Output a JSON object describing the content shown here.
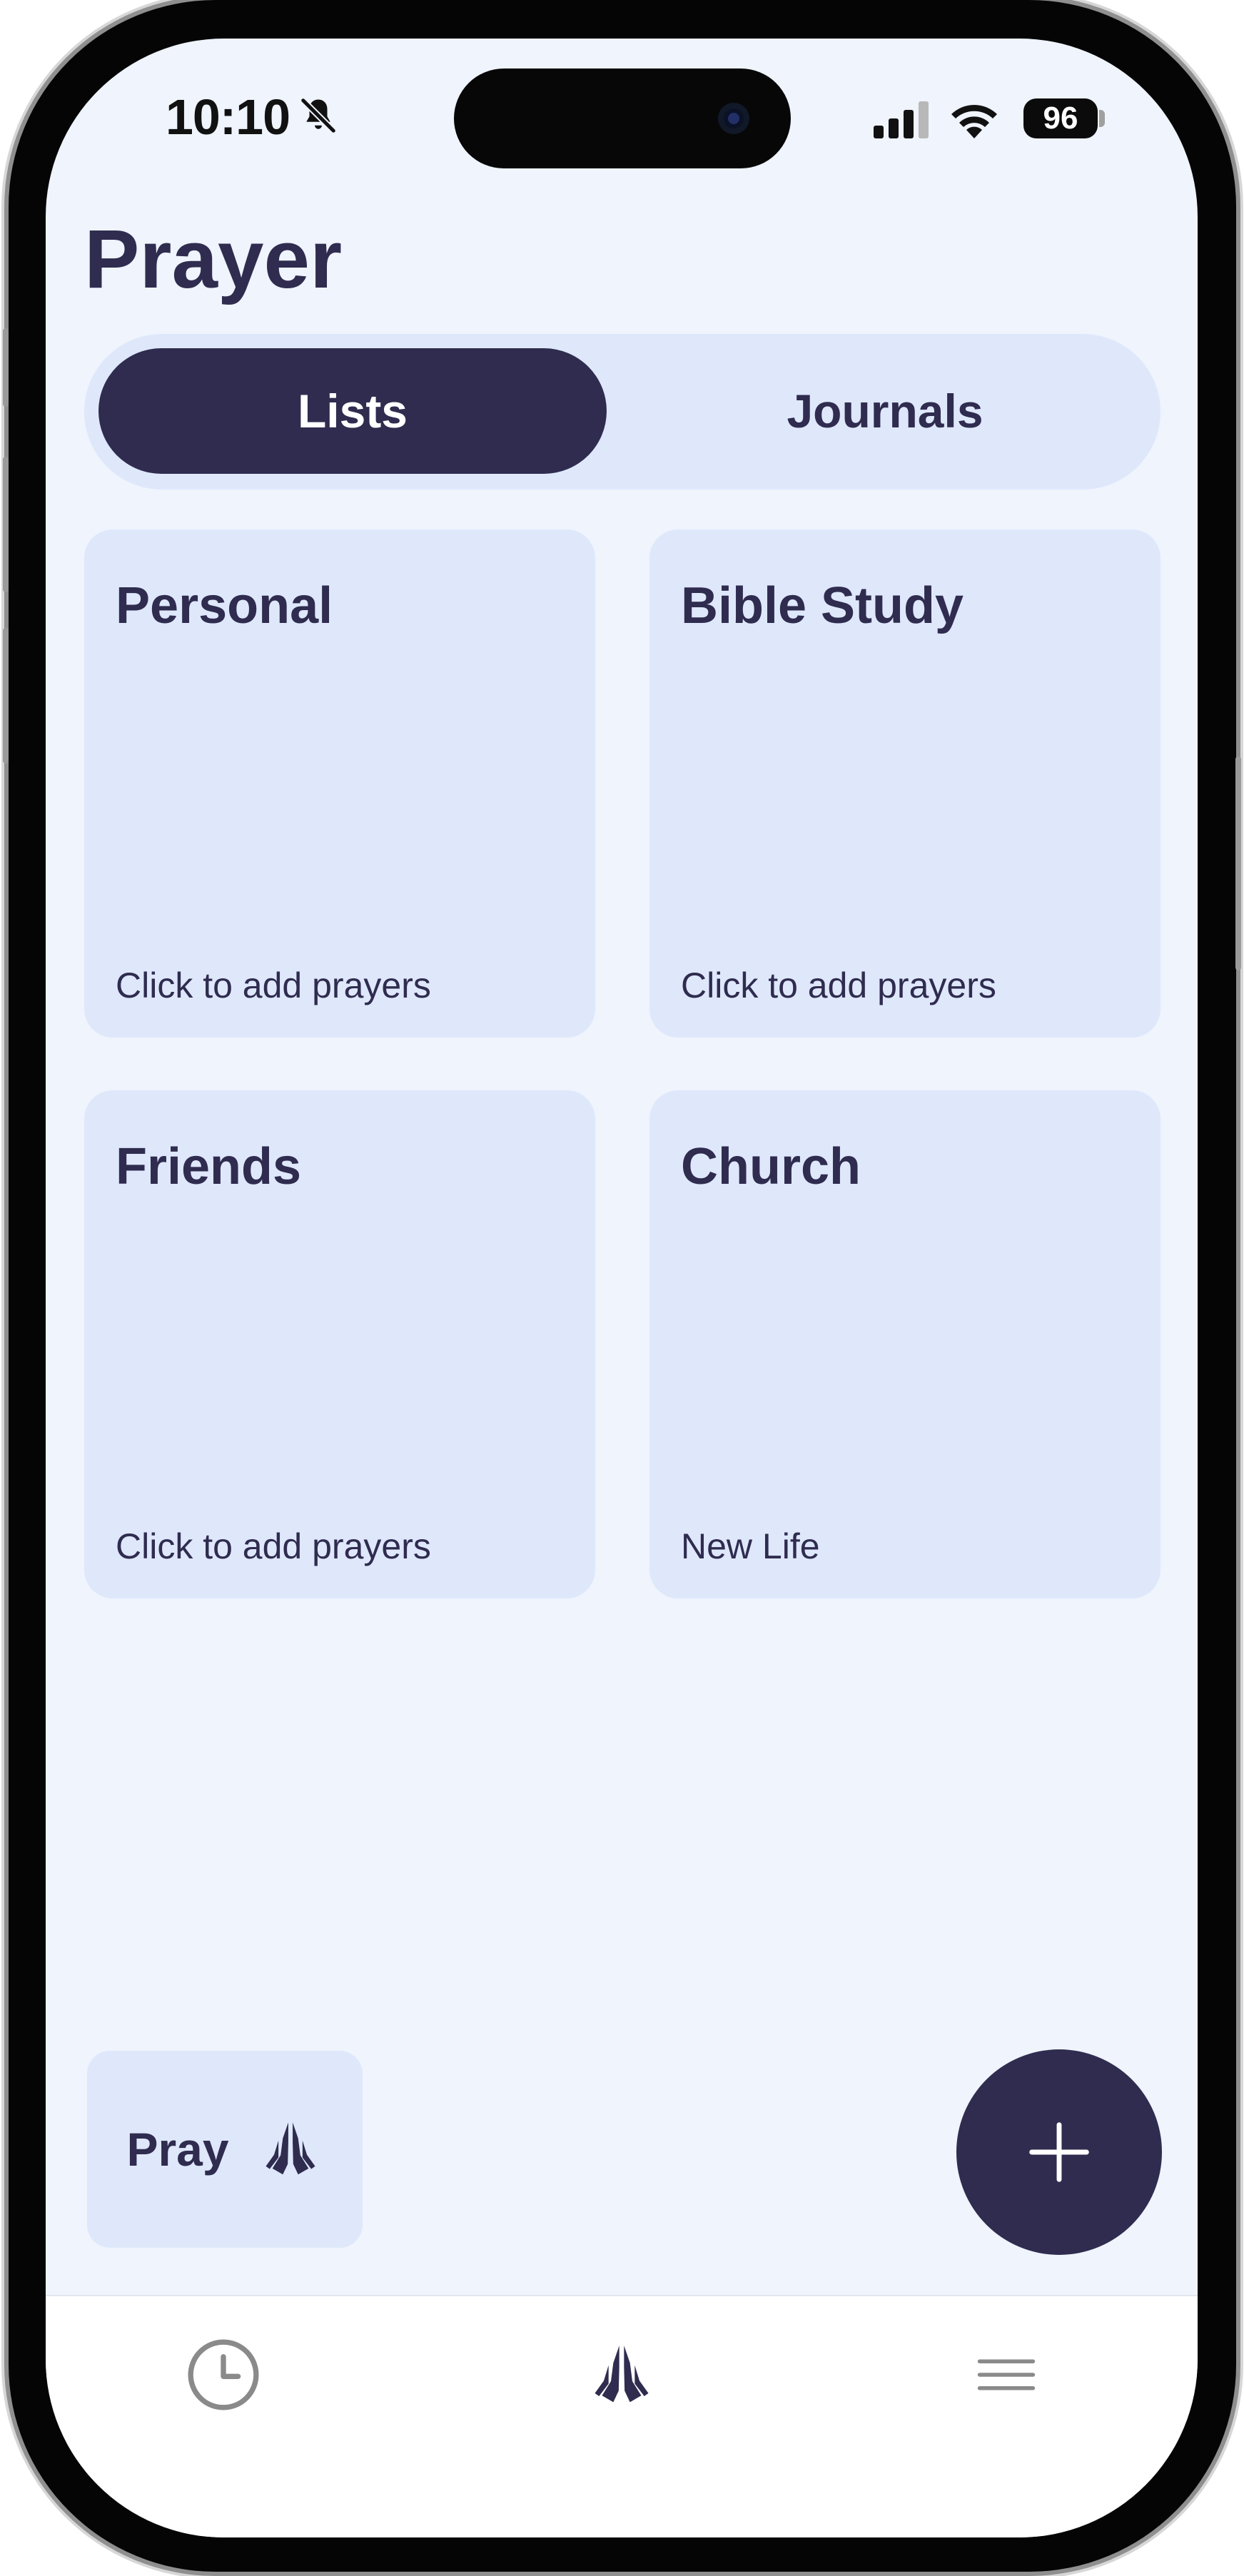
{
  "status_bar": {
    "time": "10:10",
    "battery": "96",
    "icons": [
      "bell-slash-icon",
      "cellular-signal-icon",
      "wifi-icon",
      "battery-icon"
    ]
  },
  "header": {
    "title": "Prayer"
  },
  "segmented_control": {
    "tabs": [
      {
        "label": "Lists",
        "active": true
      },
      {
        "label": "Journals",
        "active": false
      }
    ]
  },
  "lists": [
    {
      "title": "Personal",
      "subtitle": "Click to add prayers"
    },
    {
      "title": "Bible Study",
      "subtitle": "Click to add prayers"
    },
    {
      "title": "Friends",
      "subtitle": "Click to add prayers"
    },
    {
      "title": "Church",
      "subtitle": "New Life"
    }
  ],
  "pray_button": {
    "label": "Pray",
    "icon": "praying-hands-icon"
  },
  "fab": {
    "icon": "plus-icon"
  },
  "tab_bar": {
    "items": [
      {
        "name": "history",
        "icon": "clock-icon"
      },
      {
        "name": "prayer",
        "icon": "praying-hands-icon",
        "active": true
      },
      {
        "name": "menu",
        "icon": "hamburger-menu-icon"
      }
    ]
  },
  "colors": {
    "primary": "#2f2c4f",
    "card_bg": "#dfe8fb",
    "screen_bg": "#eff4fd",
    "tab_bar_bg": "#ffffff",
    "inactive_icon": "#8a8a8a"
  }
}
